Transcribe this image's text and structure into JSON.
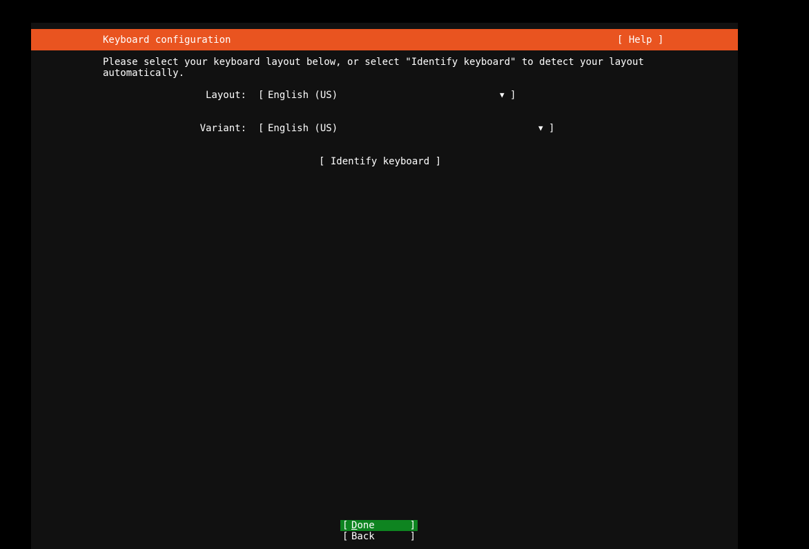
{
  "header": {
    "title": "Keyboard configuration",
    "help_label": "[ Help ]",
    "background": "#e95420"
  },
  "description": "Please select your keyboard layout below, or select \"Identify keyboard\" to detect your layout automatically.",
  "layout": {
    "label": "Layout:",
    "value": "English (US)"
  },
  "variant": {
    "label": "Variant:",
    "value": "English (US)"
  },
  "identify_label": "[ Identify keyboard ]",
  "symbols": {
    "open_bracket": "[",
    "close_bracket": "]",
    "dropdown_arrow": "▼"
  },
  "buttons": {
    "done": {
      "first_letter": "D",
      "rest": "one",
      "background": "#0e8420"
    },
    "back": {
      "label": "Back"
    }
  }
}
